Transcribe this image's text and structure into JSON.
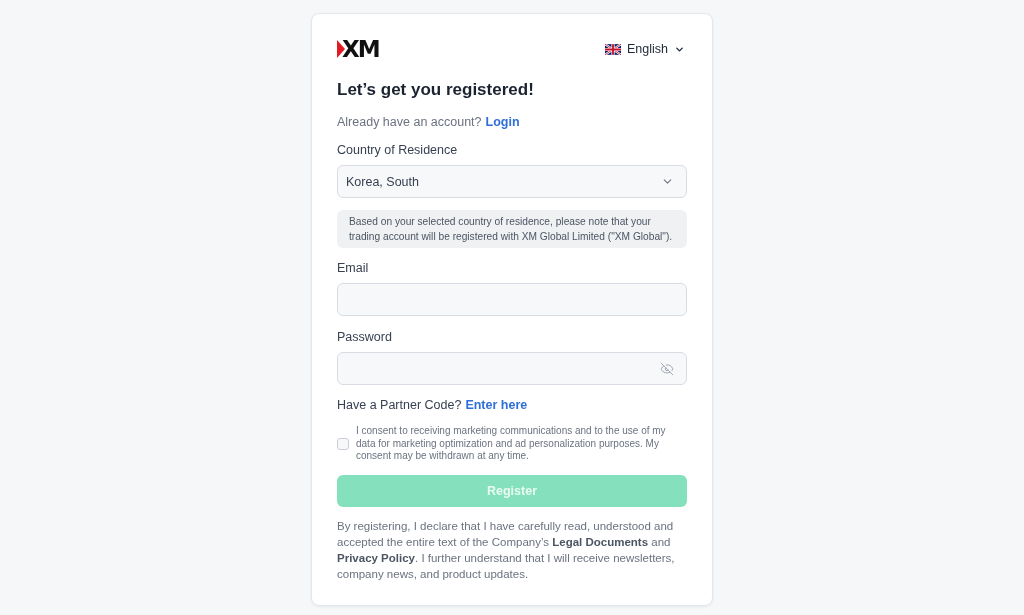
{
  "header": {
    "logo": "XM",
    "language": {
      "label": "English"
    }
  },
  "title": "Let’s get you registered!",
  "login_prompt": {
    "text": "Already have an account?",
    "link": "Login"
  },
  "country": {
    "label": "Country of Residence",
    "value": "Korea, South"
  },
  "notice": "Based on your selected country of residence, please note that your trading account will be registered with XM Global Limited (\"XM Global\").",
  "email": {
    "label": "Email"
  },
  "password": {
    "label": "Password"
  },
  "partner_prompt": {
    "text": "Have a Partner Code?",
    "link": "Enter here"
  },
  "consent": {
    "text": "I consent to receiving marketing communications and to the use of my data for marketing optimization and ad personalization purposes. My consent may be withdrawn at any time.",
    "checked": false
  },
  "register_button": {
    "label": "Register",
    "disabled": true
  },
  "legal_text": "By registering, I declare that I have carefully read, understood and accepted the entire text of the Company’s **Legal Documents** and **Privacy Policy**. I further understand that I will receive newsletters, company news, and product updates."
}
